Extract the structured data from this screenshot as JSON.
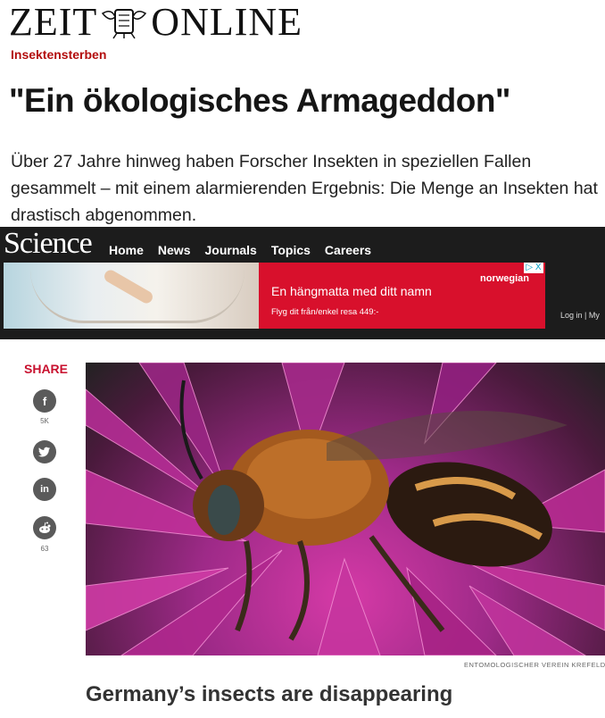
{
  "zeit": {
    "logo_left": "ZEIT",
    "logo_right": "ONLINE",
    "kicker": "Insektensterben",
    "headline": "\"Ein ökologisches Armageddon\"",
    "teaser": "Über 27 Jahre hinweg haben Forscher Insekten in speziellen Fallen gesammelt – mit einem alarmierenden Ergebnis: Die Menge an Insekten hat drastisch abgenommen."
  },
  "science": {
    "logo": "Science",
    "nav": [
      "Home",
      "News",
      "Journals",
      "Topics",
      "Careers"
    ],
    "login": "Log in | My",
    "ad": {
      "brand": "norwegian",
      "line1": "En hängmatta med ditt namn",
      "line2": "Flyg dit från/enkel resa 449:-",
      "close": "▷ X"
    }
  },
  "share": {
    "label": "SHARE",
    "buttons": [
      {
        "icon": "facebook-icon",
        "glyph": "f",
        "count": "5K"
      },
      {
        "icon": "twitter-icon",
        "glyph": "t",
        "count": ""
      },
      {
        "icon": "linkedin-icon",
        "glyph": "in",
        "count": ""
      },
      {
        "icon": "reddit-icon",
        "glyph": "r",
        "count": "63"
      }
    ]
  },
  "article": {
    "photo_credit": "ENTOMOLOGISCHER VEREIN KREFELD",
    "title": "Germany’s insects are disappearing"
  },
  "colors": {
    "kicker": "#b30d0d",
    "science_bar": "#1c1c1c",
    "ad_red": "#d8102c",
    "share_red": "#c8102e"
  }
}
